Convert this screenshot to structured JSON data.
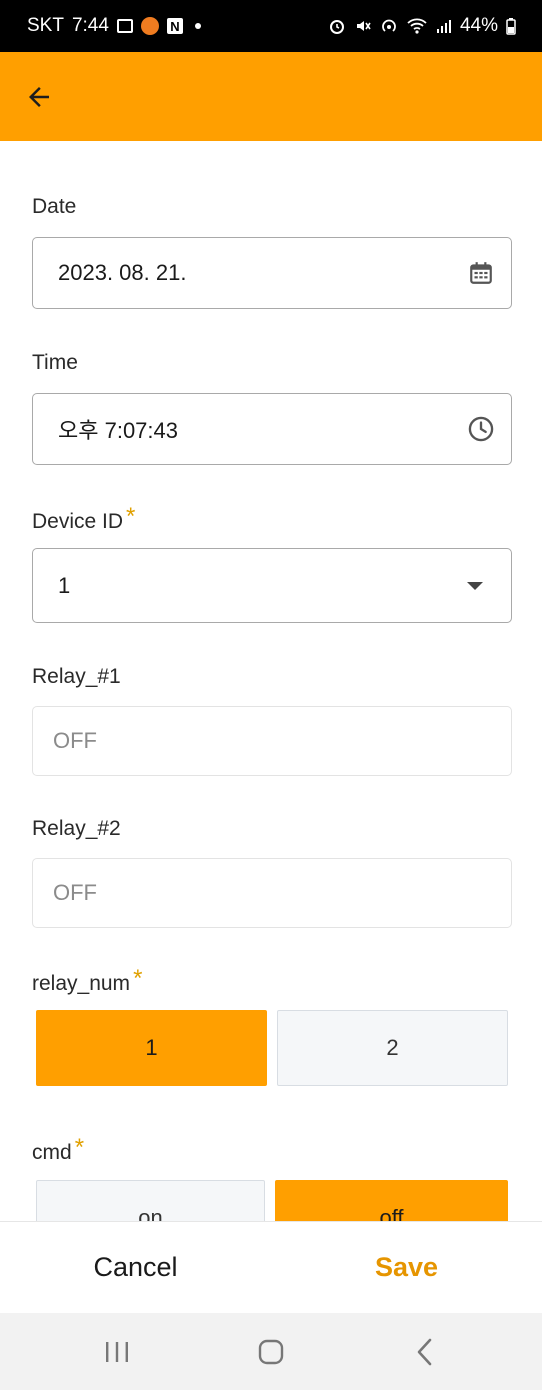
{
  "status_bar": {
    "carrier": "SKT",
    "time": "7:44",
    "battery": "44%"
  },
  "toolbar": {
    "back_icon": "arrow-left-icon"
  },
  "form": {
    "date": {
      "label": "Date",
      "value": "2023. 08. 21.",
      "icon": "calendar-icon"
    },
    "time": {
      "label": "Time",
      "value": "오후 7:07:43",
      "icon": "clock-icon"
    },
    "device_id": {
      "label": "Device ID",
      "required_mark": "*",
      "value": "1",
      "icon": "dropdown-arrow-icon"
    },
    "relay_1": {
      "label": "Relay_#1",
      "value": "OFF"
    },
    "relay_2": {
      "label": "Relay_#2",
      "value": "OFF"
    },
    "relay_num": {
      "label": "relay_num",
      "required_mark": "*",
      "options": [
        "1",
        "2"
      ],
      "selected": "1"
    },
    "cmd": {
      "label": "cmd",
      "required_mark": "*",
      "options": [
        "on",
        "off"
      ],
      "selected": "off"
    }
  },
  "actions": {
    "cancel_label": "Cancel",
    "save_label": "Save"
  },
  "colors": {
    "accent": "#ff9f00",
    "save_text": "#e69500",
    "required": "#e0a000"
  }
}
